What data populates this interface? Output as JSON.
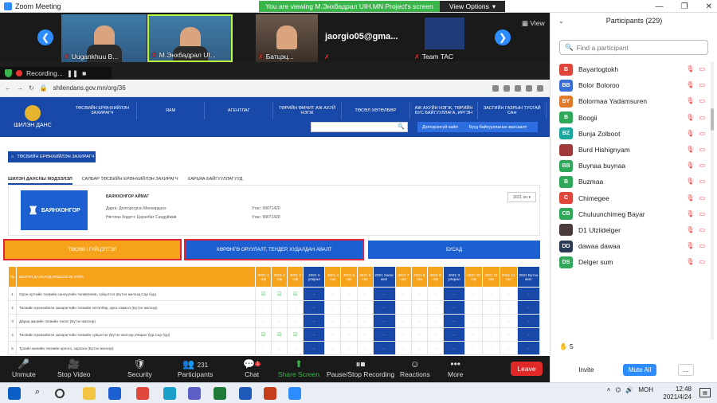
{
  "window": {
    "title": "Zoom Meeting",
    "viewing_banner": "You are viewing М.Энхбадрал UIH.MN Project's screen",
    "view_options": "View Options",
    "view_label": "View"
  },
  "gallery": [
    {
      "name": "Uugankhuu B..."
    },
    {
      "name": "М.Энхбадрал UI..."
    },
    {
      "name": "Батцэц..."
    },
    {
      "name": "jaorgio05@gma..."
    },
    {
      "name": "Team TAC"
    }
  ],
  "recording": {
    "label": "Recording..."
  },
  "browser": {
    "url": "shilendans.gov.mn/org/36"
  },
  "site": {
    "logo_text": "ШИЛЭН ДАНС",
    "nav": [
      "ТӨСВИЙН ЕРӨНХИЙЛЭН ЗАХИРАГЧ",
      "ЯАМ",
      "АГЕНТЛАГ",
      "ТӨРИЙН ӨМЧИТ АЖ АХУЙ НЭГЖ",
      "ТӨСӨЛ ХӨТӨЛБӨР",
      "АЖ АХУЙН НЭГЖ, ТӨРИЙН БУС БАЙГУУЛЛАГА, ИРГЭН",
      "ЗАСГИЙН ГАЗРЫН ТУСГАЙ САН"
    ],
    "btn_report": "Дэлгэрэнгүй хайлт",
    "btn_org": "Бүгд байгууллагын жагсаалт",
    "breadcrumb": "ТӨСВИЙН ЕРӨНХИЙЛЭН ЗАХИРАГЧ",
    "tabs": [
      "ШИЛЭН ДАНСНЫ МЭДЭЭЛЭЛ",
      "САЛБАР ТӨСВИЙН ЕРӨНХИЙЛЭН ЗАХИРАГЧ",
      "ХАРЬЯА БАЙГУУЛЛАГУУД"
    ],
    "org_logo_text": "БАЯНХОНГОР",
    "org_name": "БАЯНХОНГОР АЙМАГ",
    "rows": [
      {
        "label": "Дарга: Долгорсүрэн Мөнхөрдэнэ",
        "phone": "Утас: 99071420"
      },
      {
        "label": "Нягтлан бодогч: Цэрэнбат Сандуйжав",
        "phone": "Утас: 99071420"
      }
    ],
    "year": "2021 он",
    "categories": [
      "ТӨСӨВ / ГҮЙЦЭТГЭЛ",
      "ХӨРӨНГӨ ОРУУЛАЛТ, ТЕНДЕР, ХУДАЛДАН АВАЛТ",
      "БУСАД"
    ],
    "grid_header": {
      "num": "№",
      "desc": "ШИЛЭН ДАНСАНД МЭДЭЭЛЭХ ЗҮЙЛ"
    },
    "grid_cols": [
      "2021 1 сар",
      "2021 2 сар",
      "2021 3 сар",
      "2021 3 улирал",
      "2021 4 сар",
      "2021 5 сар",
      "2021 6 сар",
      "2021 Хагас жил",
      "2021 7 сар",
      "2021 8 сар",
      "2021 9 сар",
      "2021 3 улирал",
      "2021 10 сар",
      "2021 11 сар",
      "2021 12 сар",
      "2021 Бүтэн жил"
    ],
    "grid_rows": [
      {
        "num": "1",
        "desc": "Орон нутгийн төсвийн санхүүгийн төлөвлөгөө, гүйцэтгэл (Бүтэн жилээр,Сар бүр)"
      },
      {
        "num": "2",
        "desc": "Төсвийн ерөнхийлэн захирагчийн төсвийн хөтөлбөр, арга хэмжээ (Бүтэн жилээр)"
      },
      {
        "num": "3",
        "desc": "Дараа жилийн төсвийн төсөл (Бүтэн жилээр)"
      },
      {
        "num": "4",
        "desc": "Төсвийн ерөнхийлэн захирагчийн төсвийн гүйцэтгэл (Бүтэн жилээр,Улирал бүр,Сар бүр)"
      },
      {
        "num": "5",
        "desc": "Тухайн жилийн төсвийн орлого, зарлага (Бүтэн жилээр)"
      }
    ]
  },
  "toolbar": {
    "unmute": "Unmute",
    "stop_video": "Stop Video",
    "security": "Security",
    "participants": "Participants",
    "participants_count": "231",
    "chat": "Chat",
    "chat_badge": "1",
    "share": "Share Screen",
    "record": "Pause/Stop Recording",
    "reactions": "Reactions",
    "more": "More",
    "leave": "Leave"
  },
  "panel": {
    "title": "Participants (229)",
    "search_placeholder": "Find a participant",
    "participants": [
      {
        "initials": "B",
        "name": "Bayartogtokh",
        "color": "#e0463c"
      },
      {
        "initials": "BB",
        "name": "Bolor Boloroo",
        "color": "#3b6ed6"
      },
      {
        "initials": "BY",
        "name": "Bolormaa Yadamsuren",
        "color": "#e07a2c"
      },
      {
        "initials": "B",
        "name": "Boogii",
        "color": "#2fa85a"
      },
      {
        "initials": "BZ",
        "name": "Bunja Zolboot",
        "color": "#19a7a0"
      },
      {
        "initials": "",
        "name": "Burd Hishignyam",
        "color": "#a03a3a"
      },
      {
        "initials": "BB",
        "name": "Buynaa buynaa",
        "color": "#2fa85a"
      },
      {
        "initials": "B",
        "name": "Buzmaa",
        "color": "#2fa85a"
      },
      {
        "initials": "C",
        "name": "Chimegee",
        "color": "#e0463c"
      },
      {
        "initials": "CB",
        "name": "Chuluunchimeg Bayar",
        "color": "#2fa85a"
      },
      {
        "initials": "",
        "name": "D1 Ulziidelger",
        "color": "#4a3a3a"
      },
      {
        "initials": "DD",
        "name": "dawaa dawaa",
        "color": "#2b3a55"
      },
      {
        "initials": "DS",
        "name": "Delger  sum",
        "color": "#2fa85a"
      }
    ],
    "raised_hands": "5",
    "invite": "Invite",
    "mute_all": "Mute All",
    "more": "..."
  },
  "taskbar": {
    "lang": "МОН",
    "time": "12:48",
    "date": "2021/4/24"
  }
}
